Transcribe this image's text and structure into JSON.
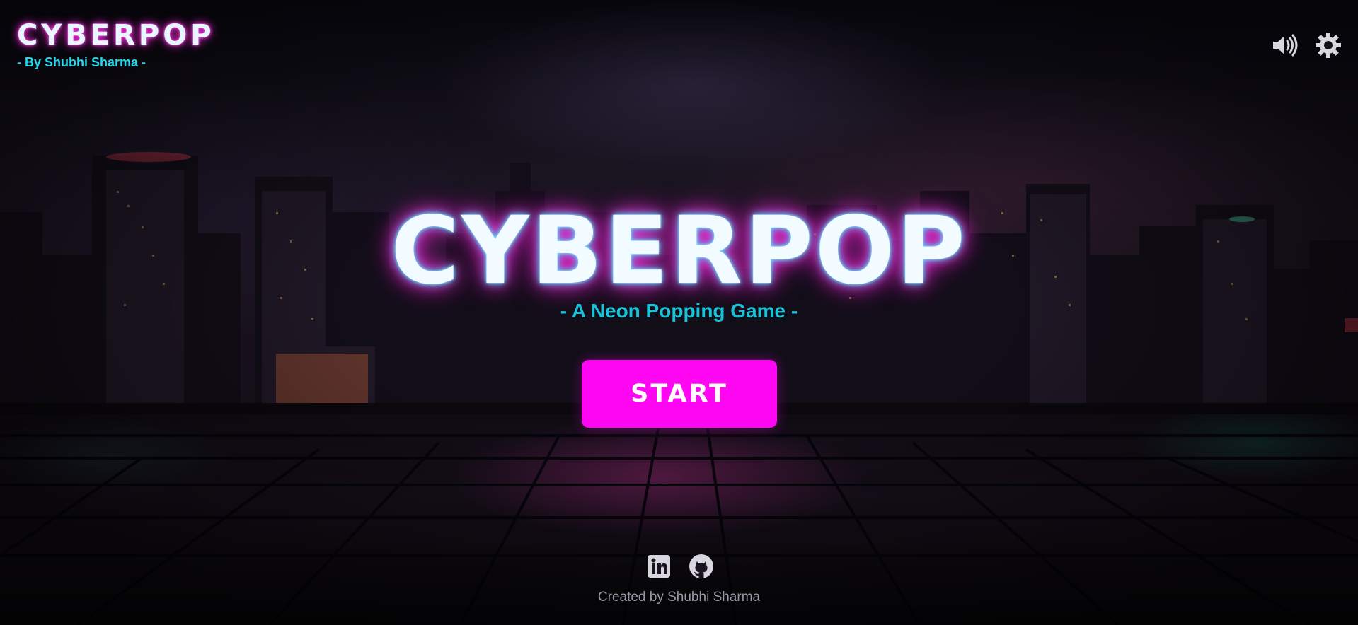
{
  "brand": {
    "title": "CYBERPOP",
    "subtitle": "- By Shubhi Sharma -"
  },
  "controls": {
    "sound_icon": "speaker-volume-icon",
    "settings_icon": "gear-icon"
  },
  "hero": {
    "title": "CYBERPOP",
    "subtitle": "- A Neon Popping Game -"
  },
  "start_button": {
    "label": "START"
  },
  "footer": {
    "socials": [
      {
        "name": "linkedin-icon"
      },
      {
        "name": "github-icon"
      }
    ],
    "credit": "Created by Shubhi Sharma"
  },
  "colors": {
    "start_button": "#ff07f2",
    "accent_cyan": "#22d7ee",
    "neon_pink": "#ff2ad8",
    "background": "#07060d"
  }
}
